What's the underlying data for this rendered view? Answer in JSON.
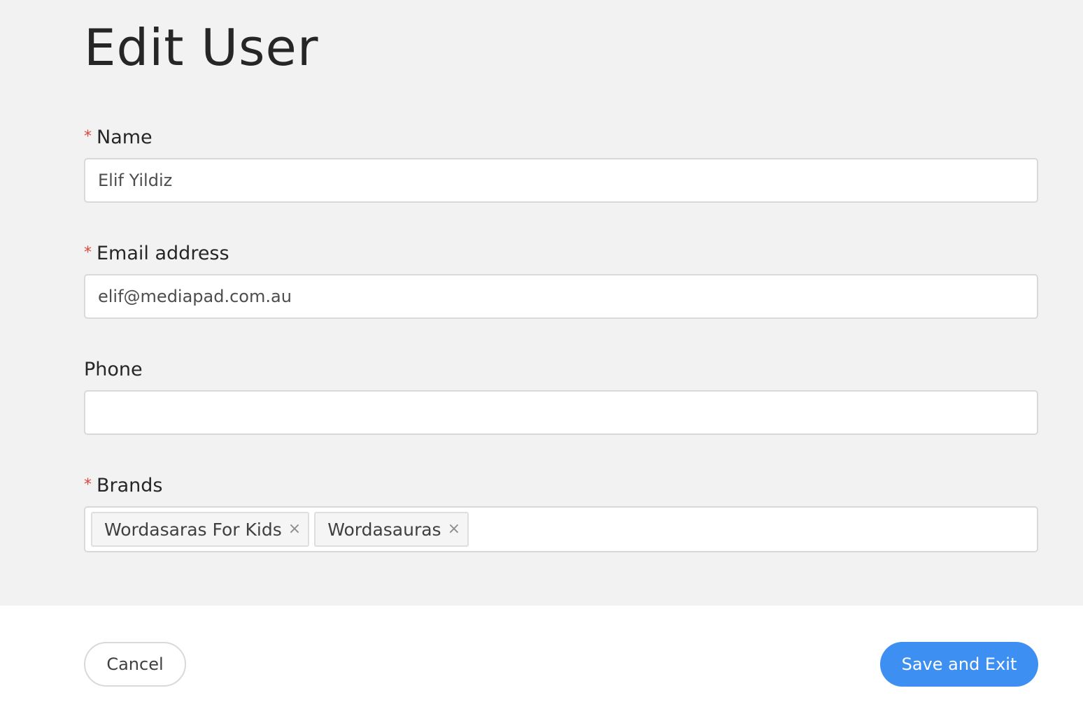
{
  "page": {
    "title": "Edit User"
  },
  "form": {
    "name": {
      "label": "Name",
      "required_mark": "*",
      "value": "Elif Yildiz"
    },
    "email": {
      "label": "Email address",
      "required_mark": "*",
      "value": "elif@mediapad.com.au"
    },
    "phone": {
      "label": "Phone",
      "value": ""
    },
    "brands": {
      "label": "Brands",
      "required_mark": "*",
      "tags": [
        {
          "label": "Wordasaras For Kids",
          "remove_icon": "×"
        },
        {
          "label": "Wordasauras",
          "remove_icon": "×"
        }
      ]
    }
  },
  "footer": {
    "cancel_label": "Cancel",
    "save_label": "Save and Exit"
  },
  "colors": {
    "accent": "#3d8ff2",
    "required": "#e0453a",
    "form_background": "#f2f2f2"
  }
}
